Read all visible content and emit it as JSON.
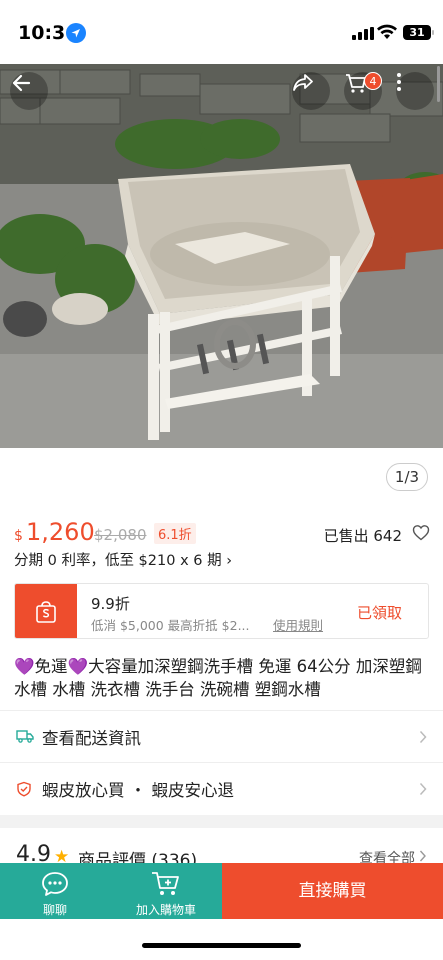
{
  "status_bar": {
    "time": "10:36",
    "battery": "31"
  },
  "header": {
    "cart_count": "4"
  },
  "gallery": {
    "pager": "1/3"
  },
  "price": {
    "currency": "$",
    "current": "1,260",
    "original": "$2,080",
    "discount": "6.1折",
    "sold": "已售出 642",
    "installment": "分期 0 利率，低至 $210 x 6 期 ›"
  },
  "voucher": {
    "title": "9.9折",
    "description": "低消 $5,000 最高折抵 $2...",
    "rule_link": "使用規則",
    "status": "已領取"
  },
  "product": {
    "title_parts": [
      "免運",
      "大容量加深塑鋼洗手槽 免運 64公分 加深塑鋼水槽 水槽 洗衣槽 洗手台 洗碗槽 塑鋼水槽"
    ]
  },
  "rows": {
    "shipping": "查看配送資訊",
    "guarantee": "蝦皮放心買 ・ 蝦皮安心退"
  },
  "reviews": {
    "score": "4.9",
    "label": "商品評價 (336)",
    "view_all": "查看全部"
  },
  "bottom_bar": {
    "chat": "聊聊",
    "add_to_cart": "加入購物車",
    "buy_now": "直接購買"
  },
  "colors": {
    "brand": "#ee4d2d",
    "teal": "#26aa99"
  },
  "icons": [
    "location-arrow-icon",
    "signal-icon",
    "wifi-icon",
    "back-arrow-icon",
    "share-icon",
    "cart-icon",
    "more-icon",
    "voucher-bag-icon",
    "heart-outline-icon",
    "truck-icon",
    "shield-icon",
    "chevron-right-icon",
    "star-icon",
    "chat-icon",
    "add-cart-icon"
  ]
}
